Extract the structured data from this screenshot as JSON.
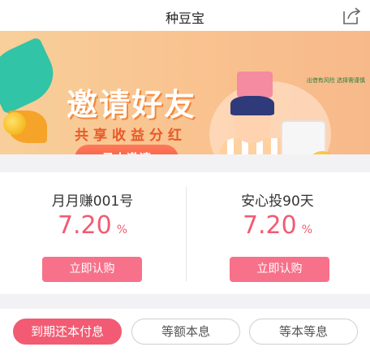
{
  "header": {
    "title": "种豆宝"
  },
  "banner": {
    "headline": "邀请好友",
    "subline": "共享收益分红",
    "cta_label": "马上邀请",
    "risk_notice": "出借有风险 选择需谨慎"
  },
  "products": [
    {
      "name": "月月赚001号",
      "rate": "7.20",
      "unit": "%",
      "buy_label": "立即认购"
    },
    {
      "name": "安心投90天",
      "rate": "7.20",
      "unit": "%",
      "buy_label": "立即认购"
    }
  ],
  "filters": [
    {
      "label": "到期还本付息",
      "active": true
    },
    {
      "label": "等额本息",
      "active": false
    },
    {
      "label": "等本等息",
      "active": false
    }
  ],
  "colors": {
    "accent": "#f25b73",
    "button": "#f7718a"
  }
}
